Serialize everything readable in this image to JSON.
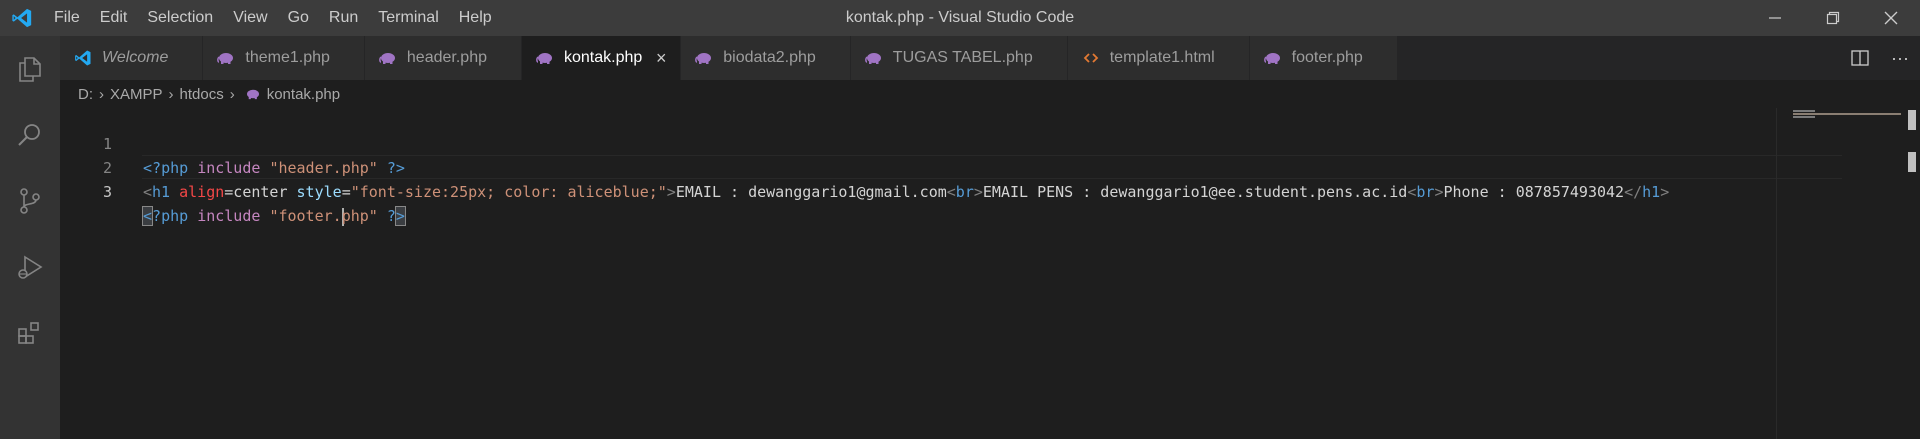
{
  "titlebar": {
    "menu": [
      "File",
      "Edit",
      "Selection",
      "View",
      "Go",
      "Run",
      "Terminal",
      "Help"
    ],
    "window_title": "kontak.php - Visual Studio Code"
  },
  "activitybar": {
    "icons": [
      "explorer-icon",
      "search-icon",
      "source-control-icon",
      "run-debug-icon",
      "extensions-icon"
    ]
  },
  "tabs": [
    {
      "label": "Welcome",
      "icon": "vscode-icon",
      "active": false
    },
    {
      "label": "theme1.php",
      "icon": "php-elephant-icon",
      "active": false
    },
    {
      "label": "header.php",
      "icon": "php-elephant-icon",
      "active": false
    },
    {
      "label": "kontak.php",
      "icon": "php-elephant-icon",
      "active": true
    },
    {
      "label": "biodata2.php",
      "icon": "php-elephant-icon",
      "active": false
    },
    {
      "label": "TUGAS TABEL.php",
      "icon": "php-elephant-icon",
      "active": false
    },
    {
      "label": "template1.html",
      "icon": "html-icon",
      "active": false
    },
    {
      "label": "footer.php",
      "icon": "php-elephant-icon",
      "active": false
    }
  ],
  "breadcrumb": [
    "D:",
    "XAMPP",
    "htdocs",
    "kontak.php"
  ],
  "editor": {
    "line_numbers": [
      "1",
      "2",
      "3"
    ],
    "line1": [
      "<?",
      "php",
      " ",
      "include",
      " ",
      "\"header.",
      "php",
      "\"",
      " ",
      "?>"
    ],
    "line2": [
      "<",
      "h1",
      " ",
      "align",
      "=center ",
      "style",
      "=",
      "\"font-size:25px; color: aliceblue;\"",
      ">",
      "EMAIL : dewanggario1@gmail.com",
      "<",
      "br",
      ">",
      "EMAIL PENS : dewanggario1@ee.student.pens.ac.id",
      "<",
      "br",
      ">",
      "Phone : 087857493042",
      "</",
      "h1",
      ">"
    ],
    "line3": [
      "<",
      "?",
      "php",
      " ",
      "include",
      " ",
      "\"footer.",
      "php",
      "\"",
      " ",
      "?",
      ">"
    ]
  },
  "colors": {
    "accent_blue": "#0078d4",
    "php_icon": "#a074c4",
    "html_icon": "#e37933",
    "editor_bg": "#1e1e1e"
  }
}
